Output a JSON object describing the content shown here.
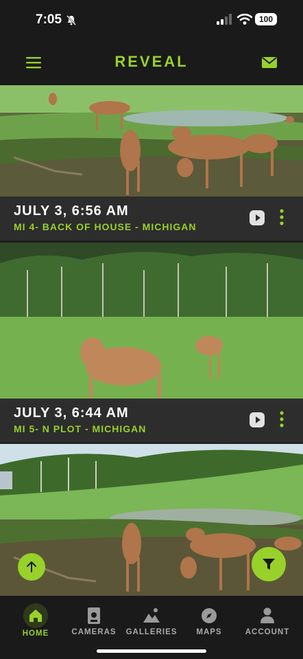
{
  "status": {
    "time": "7:05",
    "battery": "100"
  },
  "header": {
    "logo": "REVEAL"
  },
  "photos": [
    {
      "date": "JULY 3, 6:56 AM",
      "location": "MI 4- BACK OF HOUSE - MICHIGAN"
    },
    {
      "date": "JULY 3, 6:44 AM",
      "location": "MI 5- N PLOT - MICHIGAN"
    }
  ],
  "tabs": [
    {
      "label": "HOME",
      "icon": "home-icon"
    },
    {
      "label": "CAMERAS",
      "icon": "camera-icon"
    },
    {
      "label": "GALLERIES",
      "icon": "galleries-icon"
    },
    {
      "label": "MAPS",
      "icon": "compass-icon"
    },
    {
      "label": "ACCOUNT",
      "icon": "account-icon"
    }
  ],
  "colors": {
    "accent": "#98d12a",
    "background": "#1a1a1a",
    "infobar": "#2d2d2d"
  }
}
